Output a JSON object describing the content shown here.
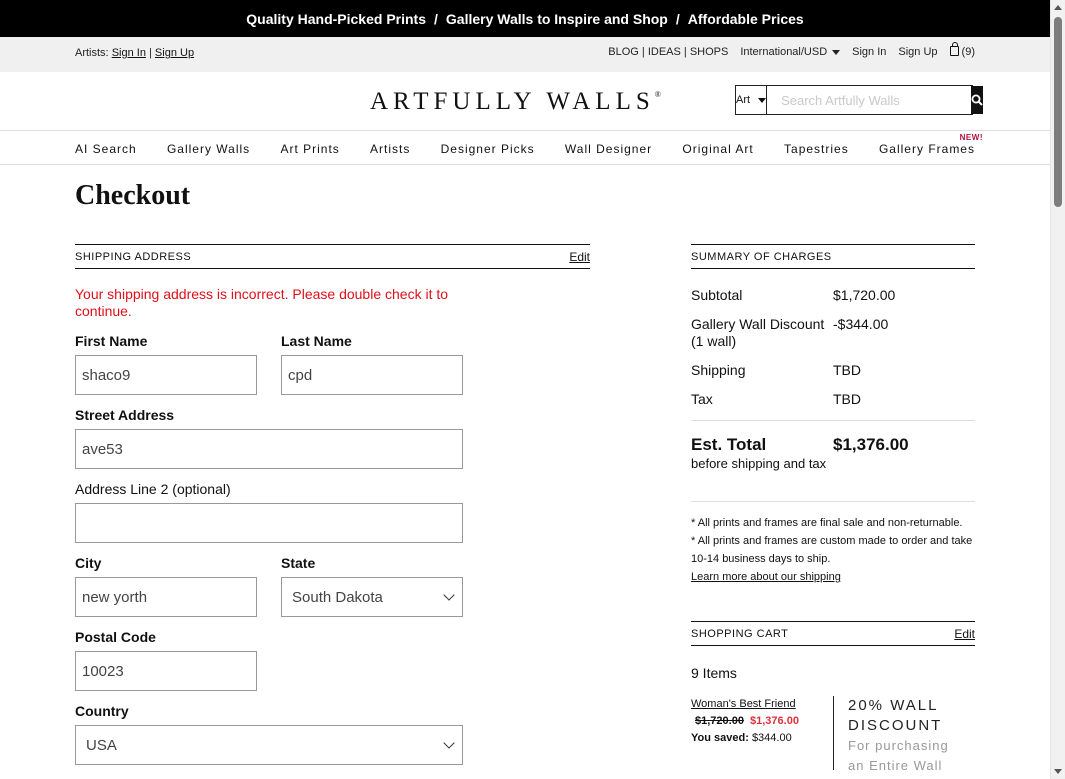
{
  "promo_bar": {
    "items": [
      "Quality Hand-Picked Prints",
      "Gallery Walls to Inspire and Shop",
      "Affordable Prices"
    ],
    "separator": "/"
  },
  "utility": {
    "artists_label": "Artists:",
    "artist_sign_in": "Sign In",
    "artist_divider": "|",
    "artist_sign_up": "Sign Up",
    "links": "BLOG | IDEAS | SHOPS",
    "region": "International/USD",
    "sign_in": "Sign In",
    "sign_up": "Sign Up",
    "cart_count": "(9)"
  },
  "header": {
    "logo": "ARTFULLY WALLS",
    "logo_mark": "®",
    "search_category": "Art",
    "search_placeholder": "Search Artfully Walls"
  },
  "nav": {
    "items": [
      "AI Search",
      "Gallery Walls",
      "Art Prints",
      "Artists",
      "Designer Picks",
      "Wall Designer",
      "Original Art",
      "Tapestries",
      "Gallery Frames"
    ],
    "new_badge": "NEW!"
  },
  "page_title": "Checkout",
  "shipping": {
    "heading": "SHIPPING ADDRESS",
    "edit": "Edit",
    "error": "Your shipping address is incorrect. Please double check it to continue.",
    "first_name_label": "First Name",
    "first_name_value": "shaco9",
    "last_name_label": "Last Name",
    "last_name_value": "cpd",
    "street_label": "Street Address",
    "street_value": "ave53",
    "address2_label": "Address Line 2 (optional)",
    "address2_value": "",
    "city_label": "City",
    "city_value": "new yorth",
    "state_label": "State",
    "state_value": "South Dakota",
    "postal_label": "Postal Code",
    "postal_value": "10023",
    "country_label": "Country",
    "country_value": "USA"
  },
  "summary": {
    "heading": "SUMMARY OF CHARGES",
    "subtotal_label": "Subtotal",
    "subtotal_value": "$1,720.00",
    "discount_label": "Gallery Wall Discount",
    "discount_sub": "(1 wall)",
    "discount_value": "-$344.00",
    "shipping_label": "Shipping",
    "shipping_value": "TBD",
    "tax_label": "Tax",
    "tax_value": "TBD",
    "total_label": "Est. Total",
    "total_sub": "before shipping and tax",
    "total_value": "$1,376.00",
    "note1": "* All prints and frames are final sale and non-returnable.",
    "note2": "* All prints and frames are custom made to order and take 10-14 business days to ship.",
    "learn_more": "Learn more about our shipping"
  },
  "cart": {
    "heading": "SHOPPING CART",
    "edit": "Edit",
    "items_count": "9 Items",
    "item_name": "Woman's Best Friend",
    "item_old_price": "$1,720.00",
    "item_new_price": "$1,376.00",
    "item_saved_label": "You saved:",
    "item_saved_value": "$344.00",
    "promo_title_1": "20% WALL",
    "promo_title_2": "DISCOUNT",
    "promo_sub_1": "For purchasing",
    "promo_sub_2": "an Entire Wall"
  },
  "colors": {
    "error": "#e0101a",
    "sale_price": "#e0303a",
    "new_badge": "#b5103a",
    "promo_bar": "#000000"
  }
}
